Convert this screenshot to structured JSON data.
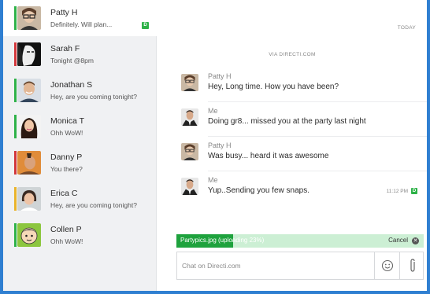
{
  "colors": {
    "accent": "#2f7fd1",
    "online": "#2eb248",
    "busy": "#d2363a",
    "away": "#eab42b"
  },
  "contacts": [
    {
      "name": "Patty H",
      "preview": "Definitely. Will plan...",
      "status": "green",
      "badge": "D",
      "active": true,
      "avatar": "woman-glasses"
    },
    {
      "name": "Sarah F",
      "preview": "Tonight @8pm",
      "status": "red",
      "avatar": "woman-bw"
    },
    {
      "name": "Jonathan S",
      "preview": "Hey, are you coming tonight?",
      "status": "green",
      "avatar": "man-smile"
    },
    {
      "name": "Monica T",
      "preview": "Ohh WoW!",
      "status": "green",
      "avatar": "woman-dark-hair"
    },
    {
      "name": "Danny P",
      "preview": "You there?",
      "status": "red",
      "avatar": "man-mohawk"
    },
    {
      "name": "Erica C",
      "preview": "Hey, are you coming tonight?",
      "status": "yellow",
      "avatar": "woman-short-hair"
    },
    {
      "name": "Collen P",
      "preview": "Ohh WoW!",
      "status": "green",
      "avatar": "cartoon-boy"
    }
  ],
  "chat": {
    "today": "TODAY",
    "via": "VIA DIRECTI.COM",
    "messages": [
      {
        "sender": "Patty H",
        "text": "Hey, Long time. How you have been?",
        "avatar": "woman-glasses"
      },
      {
        "sender": "Me",
        "text": "Doing gr8... missed you at the party last night",
        "avatar": "man-suit"
      },
      {
        "sender": "Patty H",
        "text": "Was busy... heard it was awesome",
        "avatar": "woman-glasses"
      },
      {
        "sender": "Me",
        "text": "Yup..Sending you few snaps.",
        "avatar": "man-suit",
        "time": "11:12 PM",
        "badge": "D"
      }
    ]
  },
  "upload": {
    "label": "Partypics.jpg (uploading 23%)",
    "progress": 0.23,
    "cancel": "Cancel"
  },
  "composer": {
    "placeholder": "Chat on Directi.com"
  }
}
